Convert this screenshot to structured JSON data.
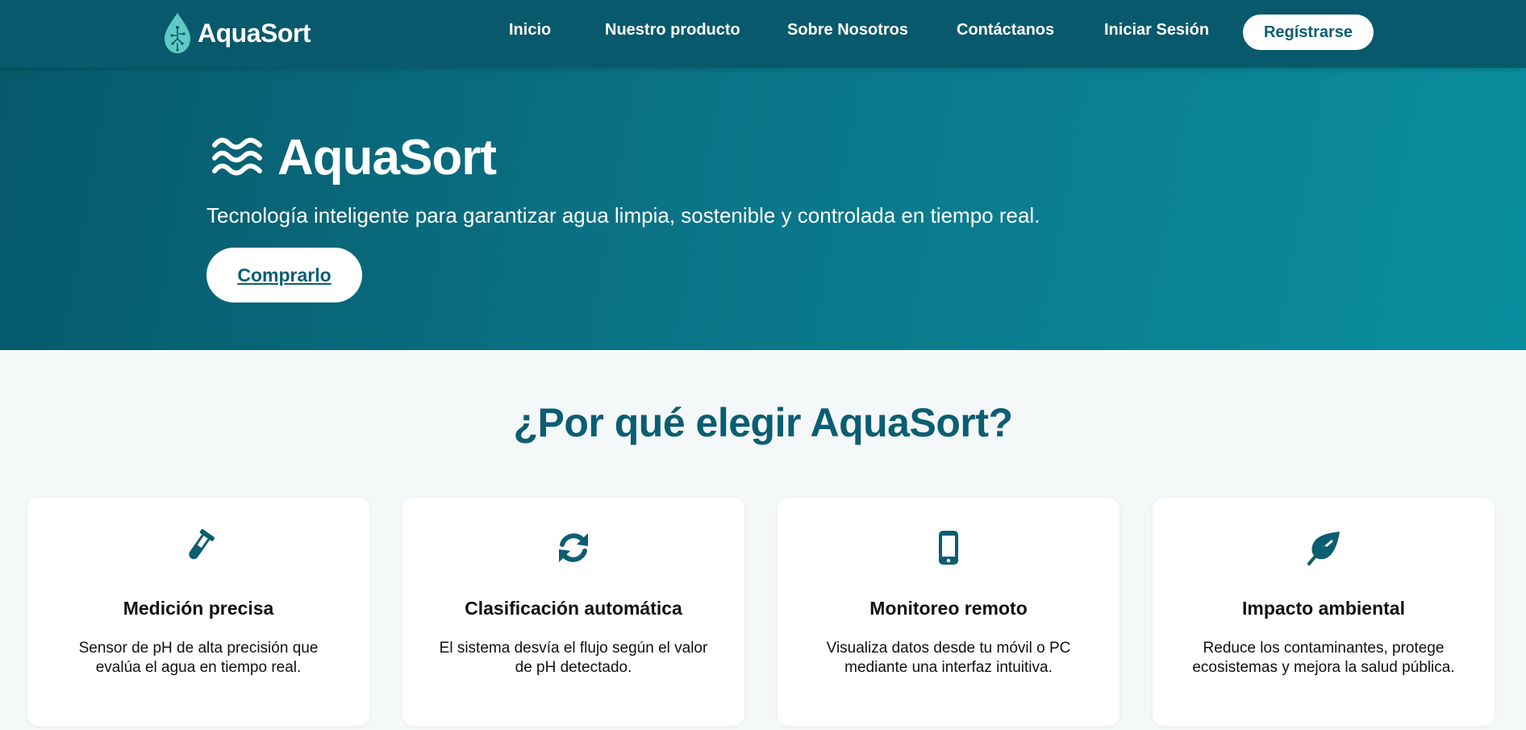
{
  "brand": {
    "name": "AquaSort",
    "logo_icon": "water-drop-circuit-icon"
  },
  "nav": {
    "items": [
      "Inicio",
      "Nuestro producto",
      "Sobre Nosotros",
      "Contáctanos",
      "Iniciar Sesión"
    ],
    "register_label": "Regístrarse"
  },
  "hero": {
    "icon": "waves-icon",
    "title": "AquaSort",
    "subtitle": "Tecnología inteligente para garantizar agua limpia, sostenible y controlada en tiempo real.",
    "cta_label": "Comprarlo"
  },
  "features": {
    "title": "¿Por qué elegir AquaSort?",
    "cards": [
      {
        "icon": "test-tube-icon",
        "title": "Medición precisa",
        "text": "Sensor de pH de alta precisión que evalúa el agua en tiempo real."
      },
      {
        "icon": "sync-icon",
        "title": "Clasificación automática",
        "text": "El sistema desvía el flujo según el valor de pH detectado."
      },
      {
        "icon": "mobile-icon",
        "title": "Monitoreo remoto",
        "text": "Visualiza datos desde tu móvil o PC mediante una interfaz intuitiva."
      },
      {
        "icon": "leaf-icon",
        "title": "Impacto ambiental",
        "text": "Reduce los contaminantes, protege ecosistemas y mejora la salud pública."
      }
    ]
  },
  "colors": {
    "navbar": "#08596b",
    "hero_start": "#06596a",
    "hero_end": "#0a8e9e",
    "accent": "#0b5e72",
    "logo_teal": "#5fc9c6"
  }
}
